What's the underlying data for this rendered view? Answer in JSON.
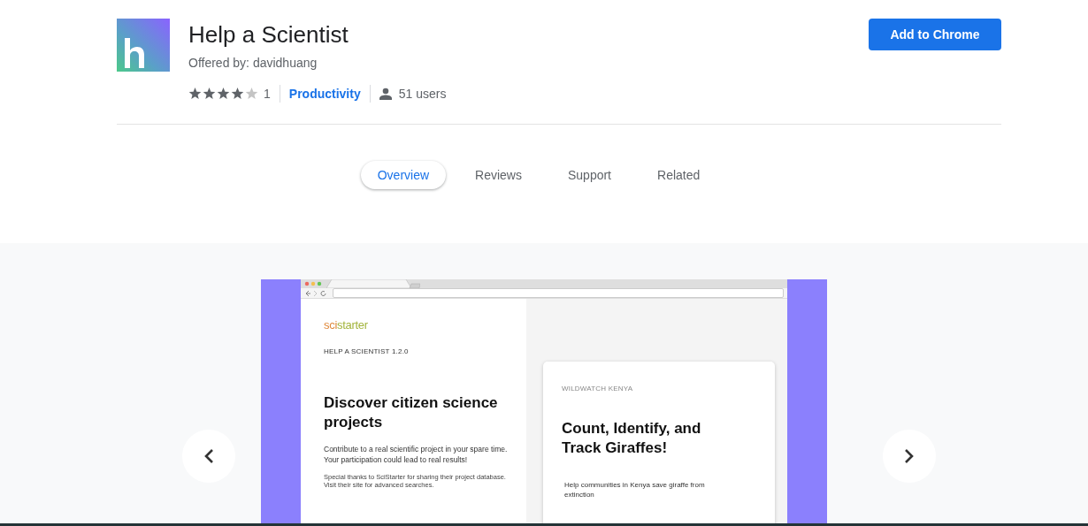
{
  "extension": {
    "title": "Help a Scientist",
    "offered_by": "Offered by: davidhuang",
    "stars": 4,
    "rating_count": "1",
    "category": "Productivity",
    "users": "51 users"
  },
  "add_button": "Add to Chrome",
  "tabs": [
    {
      "label": "Overview",
      "selected": true
    },
    {
      "label": "Reviews",
      "selected": false
    },
    {
      "label": "Support",
      "selected": false
    },
    {
      "label": "Related",
      "selected": false
    }
  ],
  "screenshot": {
    "logo": [
      "sci",
      "starter"
    ],
    "version": "HELP A SCIENTIST 1.2.0",
    "heading": "Discover citizen science projects",
    "intro": "Contribute to a real scientific project in your spare time. Your participation could lead to real results!",
    "thanks": "Special thanks to SciStarter for sharing their project database. Visit their site for advanced searches.",
    "card": {
      "label": "WILDWATCH KENYA",
      "heading": "Count, Identify, and Track Giraffes!",
      "text": "Help communities in Kenya save giraffe from extinction"
    }
  }
}
